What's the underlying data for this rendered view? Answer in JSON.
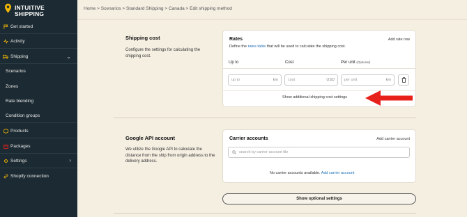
{
  "brand": {
    "line1": "INTUITIVE",
    "line2": "SHIPPING"
  },
  "sidebar": {
    "items": [
      {
        "label": "Get started",
        "icon": "flag-icon"
      },
      {
        "label": "Activity",
        "icon": "activity-icon"
      },
      {
        "label": "Shipping",
        "icon": "truck-icon"
      },
      {
        "label": "Scenarios"
      },
      {
        "label": "Zones"
      },
      {
        "label": "Rate blending"
      },
      {
        "label": "Condition groups"
      },
      {
        "label": "Products",
        "icon": "box-icon"
      },
      {
        "label": "Packages",
        "icon": "package-icon"
      },
      {
        "label": "Settings",
        "icon": "gear-icon"
      },
      {
        "label": "Shopify connection",
        "icon": "link-icon"
      }
    ]
  },
  "breadcrumb": "Home > Scenarios > Standard Shipping > Canada > Edit shipping method",
  "shipping_cost": {
    "title": "Shipping cost",
    "desc": "Configure the settings for calculating the shipping cost."
  },
  "rates": {
    "title": "Rates",
    "add_link": "Add rate row",
    "desc_pre": "Define the",
    "desc_link": "rates table",
    "desc_post": "that will be used to calculate the shipping cost.",
    "col_upto": "Up to",
    "col_cost": "Cost",
    "col_perunit": "Per unit",
    "col_optional": "(Optional)",
    "upto_placeholder": "up to",
    "upto_unit": "km",
    "cost_placeholder": "cost",
    "cost_unit": "USD",
    "perunit_placeholder": "per unit",
    "perunit_unit": "km",
    "additional_link": "Show additional shipping cost settings"
  },
  "google_api": {
    "title": "Google API account",
    "desc": "We utilize the Google API to calculate the distance from the ship from origin address to the delivery address."
  },
  "carrier": {
    "title": "Carrier accounts",
    "add_link": "Add carrier account",
    "search_placeholder": "search by carrier account tile",
    "empty_text": "No carrier accounts available.",
    "empty_link": "Add carrier account"
  },
  "optional_button": "Show optional settings",
  "colors": {
    "sidebar": "#1c2b33",
    "accent": "#f2b705",
    "link": "#1f6fb3",
    "arrow": "#e8201a",
    "background": "#f5efe2"
  }
}
